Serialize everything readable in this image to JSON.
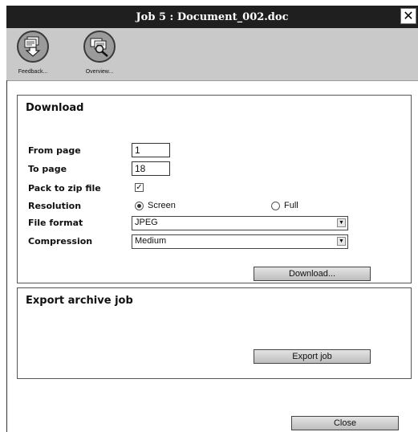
{
  "window": {
    "title": "Job 5 : Document_002.doc"
  },
  "toolbar": {
    "items": [
      {
        "label": "Feedback...",
        "icon": "feedback-download-icon"
      },
      {
        "label": "Overview...",
        "icon": "overview-magnifier-icon"
      }
    ]
  },
  "download": {
    "heading": "Download",
    "from_page_label": "From page",
    "from_page_value": "1",
    "to_page_label": "To page",
    "to_page_value": "18",
    "zip_label": "Pack to zip file",
    "zip_checked": "✓",
    "resolution_label": "Resolution",
    "resolution_options": [
      "Screen",
      "Full"
    ],
    "file_format_label": "File format",
    "file_format_value": "JPEG",
    "compression_label": "Compression",
    "compression_value": "Medium",
    "button_label": "Download..."
  },
  "export": {
    "heading": "Export archive job",
    "button_label": "Export job"
  },
  "footer": {
    "close_label": "Close"
  }
}
